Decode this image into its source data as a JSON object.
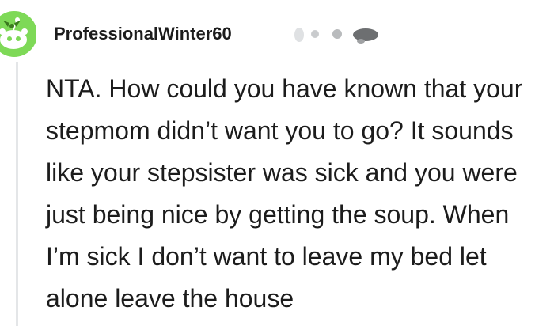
{
  "comment": {
    "avatar_icon": "snoo-avatar-icon",
    "avatar_color": "#7ed957",
    "author": "ProfessionalWinter60",
    "body": "NTA. How could you have known that your stepmom didn’t want you to go? It sounds like your stepsister was sick and you were just being nice by getting the soup. When I’m sick I don’t want to leave my bed let alone leave the house"
  }
}
